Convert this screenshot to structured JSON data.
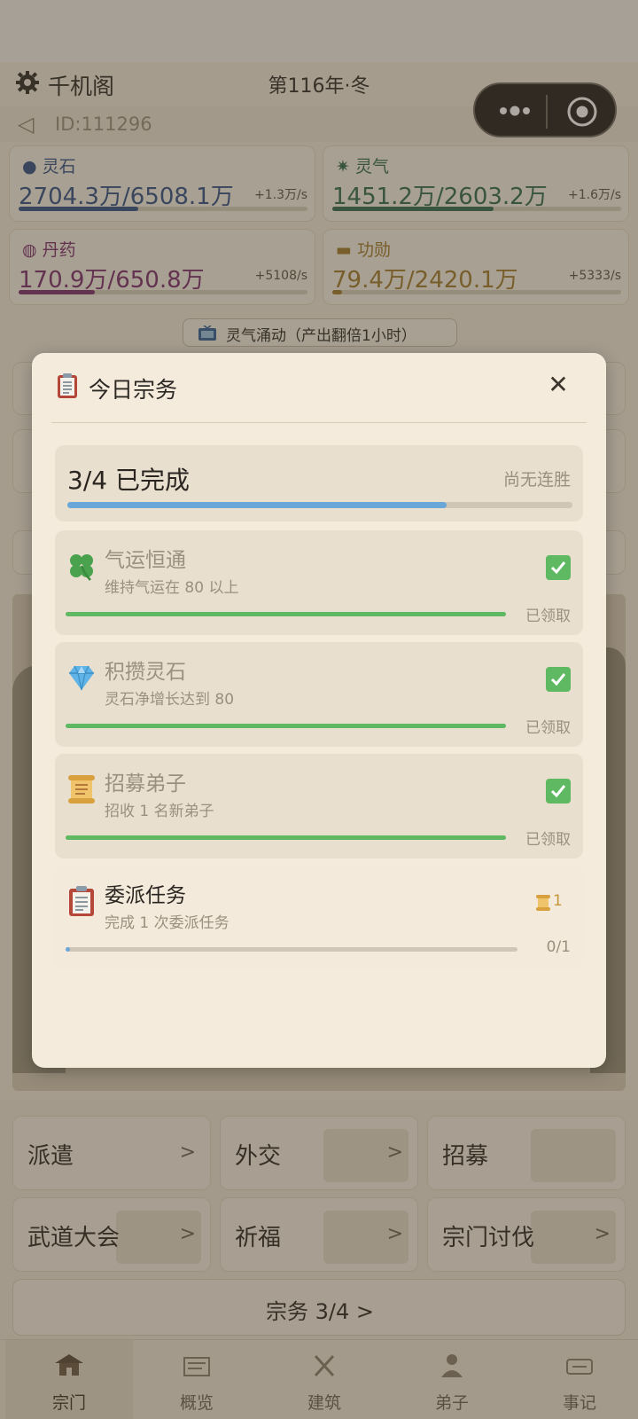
{
  "header": {
    "sect_name": "千机阁",
    "year": "第116年·冬"
  },
  "id_row": {
    "id": "ID:111296",
    "right_value": "0"
  },
  "resources": [
    {
      "name": "灵石",
      "value": "2704.3万/6508.1万",
      "rate": "+1.3万/s",
      "fill": 0.415,
      "color": "#2f4f86",
      "icon": "spirit-stone-icon"
    },
    {
      "name": "灵气",
      "value": "1451.2万/2603.2万",
      "rate": "+1.6万/s",
      "fill": 0.557,
      "color": "#2f6b4f",
      "icon": "spirit-energy-icon"
    },
    {
      "name": "丹药",
      "value": "170.9万/650.8万",
      "rate": "+5108/s",
      "fill": 0.263,
      "color": "#7a2a6e",
      "icon": "pill-icon"
    },
    {
      "name": "功勋",
      "value": "79.4万/2420.1万",
      "rate": "+5333/s",
      "fill": 0.033,
      "color": "#a07a2a",
      "icon": "merit-icon"
    }
  ],
  "boost": {
    "label": "灵气涌动（产出翻倍1小时）"
  },
  "modal": {
    "title": "今日宗务",
    "summary": {
      "completed_text": "3/4 已完成",
      "streak_text": "尚无连胜",
      "progress": 0.75
    },
    "tasks": [
      {
        "name": "气运恒通",
        "desc": "维持气运在 80 以上",
        "status": "已领取",
        "progress": 1.0,
        "icon": "clover-icon",
        "done": true
      },
      {
        "name": "积攒灵石",
        "desc": "灵石净增长达到 80",
        "status": "已领取",
        "progress": 1.0,
        "icon": "diamond-icon",
        "done": true
      },
      {
        "name": "招募弟子",
        "desc": "招收 1 名新弟子",
        "status": "已领取",
        "progress": 1.0,
        "icon": "scroll-icon",
        "done": true
      },
      {
        "name": "委派任务",
        "desc": "完成 1 次委派任务",
        "status": "0/1",
        "progress": 0.01,
        "icon": "clipboard-icon",
        "done": false,
        "reward": "1"
      }
    ]
  },
  "actions": [
    {
      "label": "派遣",
      "arrow": ">"
    },
    {
      "label": "外交",
      "arrow": ">"
    },
    {
      "label": "招募",
      "arrow": ""
    },
    {
      "label": "武道大会",
      "arrow": ">"
    },
    {
      "label": "祈福",
      "arrow": ">"
    },
    {
      "label": "宗门讨伐",
      "arrow": ">"
    }
  ],
  "duty_button": {
    "label": "宗务 3/4 >"
  },
  "tabs": [
    {
      "label": "宗门",
      "icon": "sect-tab-icon",
      "active": true
    },
    {
      "label": "概览",
      "icon": "overview-tab-icon",
      "active": false
    },
    {
      "label": "建筑",
      "icon": "building-tab-icon",
      "active": false
    },
    {
      "label": "弟子",
      "icon": "disciple-tab-icon",
      "active": false
    },
    {
      "label": "事记",
      "icon": "records-tab-icon",
      "active": false
    }
  ],
  "colors": {
    "accent_blue": "#6aa7d9",
    "done_green": "#5fb862",
    "reward_gold": "#c6973a"
  }
}
